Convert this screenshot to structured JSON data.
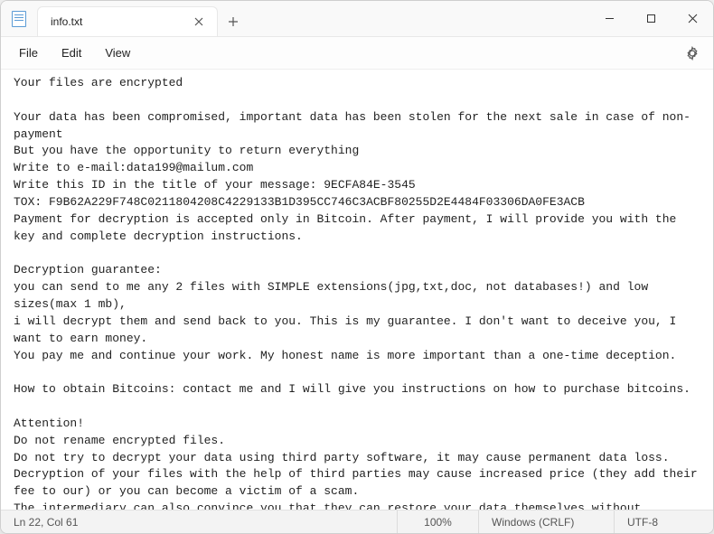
{
  "tab": {
    "title": "info.txt"
  },
  "menu": {
    "file": "File",
    "edit": "Edit",
    "view": "View"
  },
  "editor": {
    "content": "Your files are encrypted\n\nYour data has been compromised, important data has been stolen for the next sale in case of non-payment\nBut you have the opportunity to return everything\nWrite to e-mail:data199@mailum.com\nWrite this ID in the title of your message: 9ECFA84E-3545\nTOX: F9B62A229F748C0211804208C4229133B1D395CC746C3ACBF80255D2E4484F03306DA0FE3ACB\nPayment for decryption is accepted only in Bitcoin. After payment, I will provide you with the key and complete decryption instructions.\n\nDecryption guarantee:\nyou can send to me any 2 files with SIMPLE extensions(jpg,txt,doc, not databases!) and low sizes(max 1 mb),\ni will decrypt them and send back to you. This is my guarantee. I don't want to deceive you, I want to earn money.\nYou pay me and continue your work. My honest name is more important than a one-time deception.\n\nHow to obtain Bitcoins: contact me and I will give you instructions on how to purchase bitcoins.\n\nAttention!\nDo not rename encrypted files.\nDo not try to decrypt your data using third party software, it may cause permanent data loss.\nDecryption of your files with the help of third parties may cause increased price (they add their fee to our) or you can become a victim of a scam.\nThe intermediary can also convince you that they can restore your data themselves without contacting us,\nthis is not true, any recovery takes place only with my key."
  },
  "status": {
    "position": "Ln 22, Col 61",
    "zoom": "100%",
    "eol": "Windows (CRLF)",
    "encoding": "UTF-8"
  }
}
